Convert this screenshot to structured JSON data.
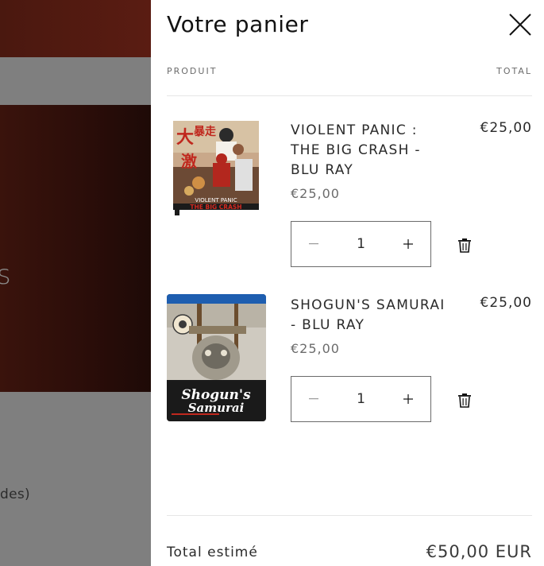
{
  "background": {
    "hero_fragment": "s",
    "lower_text_fragment": "des)"
  },
  "cart": {
    "title": "Votre panier",
    "column_product": "PRODUIT",
    "column_total": "TOTAL",
    "items": [
      {
        "name": "VIOLENT PANIC : THE BIG CRASH - BLU RAY",
        "unit_price": "€25,00",
        "line_total": "€25,00",
        "quantity": "1",
        "image_caption_1": "VIOLENT PANIC",
        "image_caption_2": "THE BIG CRASH"
      },
      {
        "name": "SHOGUN'S SAMURAI - BLU RAY",
        "unit_price": "€25,00",
        "line_total": "€25,00",
        "quantity": "1",
        "image_caption_1": "Shogun's",
        "image_caption_2": "Samurai"
      }
    ],
    "estimated_total_label": "Total estimé",
    "estimated_total_value": "€50,00 EUR"
  },
  "icons": {
    "close": "close-icon",
    "minus": "minus-icon",
    "plus": "plus-icon",
    "delete": "trash-icon"
  },
  "colors": {
    "drawer_bg": "#ffffff",
    "overlay": "#7f7f7f",
    "text": "#121212"
  }
}
